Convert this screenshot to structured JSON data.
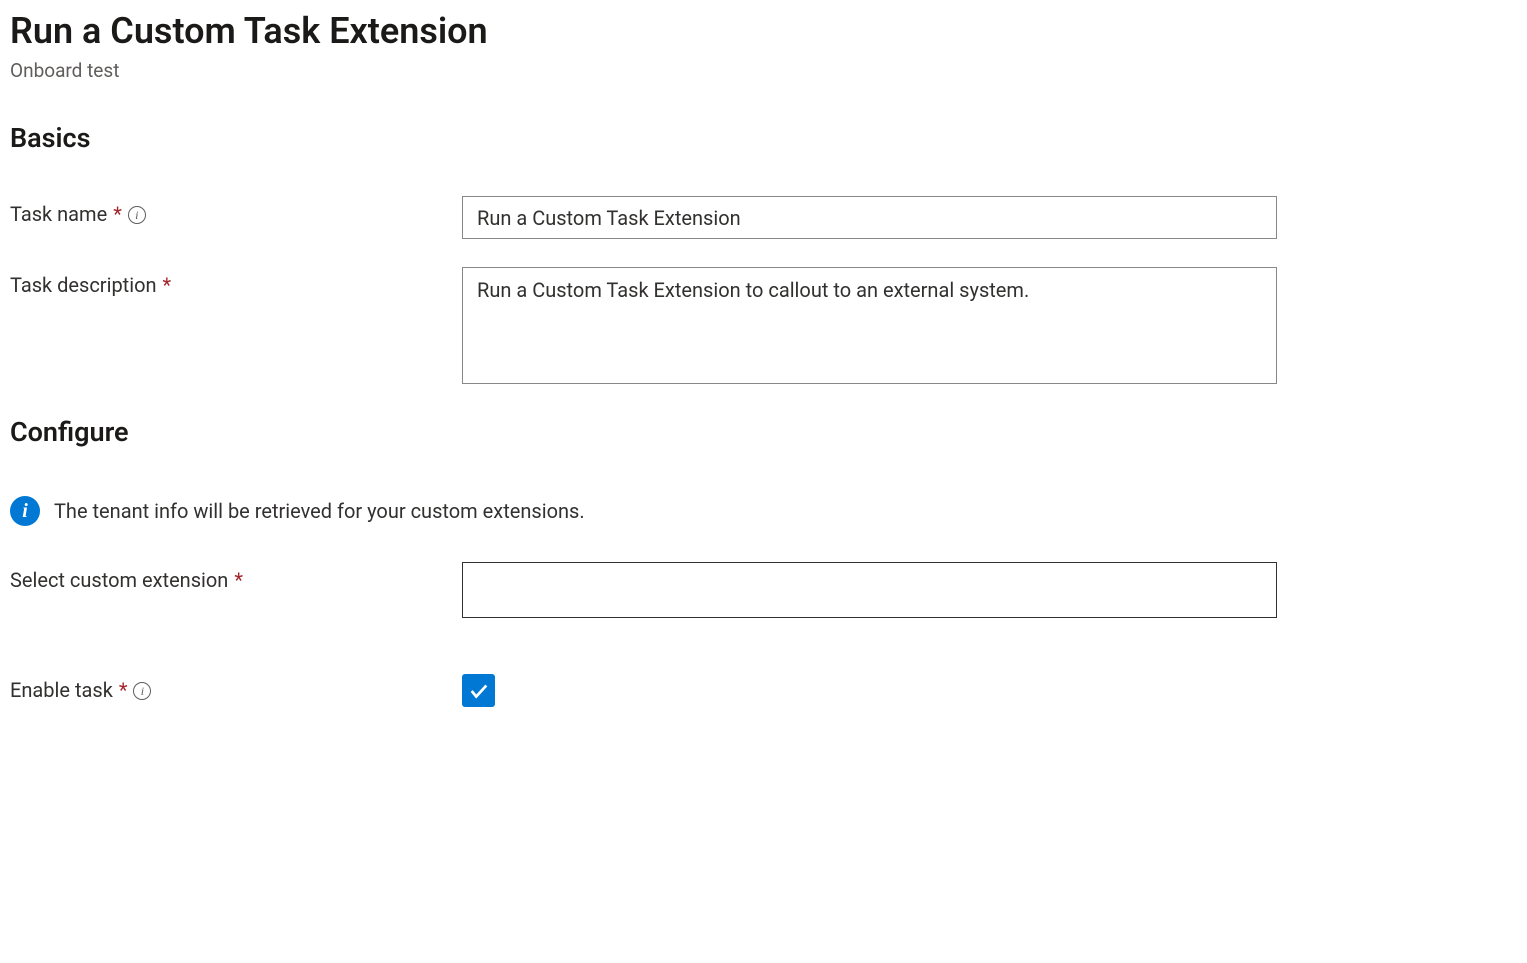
{
  "page": {
    "title": "Run a Custom Task Extension",
    "subtitle": "Onboard test"
  },
  "sections": {
    "basics": {
      "heading": "Basics",
      "task_name_label": "Task name",
      "task_name_value": "Run a Custom Task Extension",
      "task_description_label": "Task description",
      "task_description_value": "Run a Custom Task Extension to callout to an external system."
    },
    "configure": {
      "heading": "Configure",
      "info_message": "The tenant info will be retrieved for your custom extensions.",
      "select_extension_label": "Select custom extension",
      "select_extension_value": "",
      "enable_task_label": "Enable task",
      "enable_task_checked": true
    }
  }
}
